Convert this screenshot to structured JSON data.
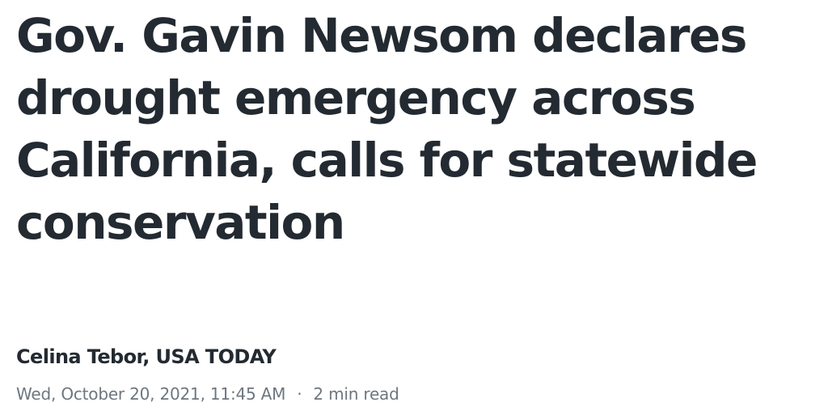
{
  "article": {
    "headline": "Gov. Gavin Newsom declares drought emergency across California, calls for statewide conservation",
    "byline": "Celina Tebor, USA TODAY",
    "timestamp": "Wed, October 20, 2021, 11:45 AM",
    "separator": "·",
    "read_time": "2 min read"
  }
}
